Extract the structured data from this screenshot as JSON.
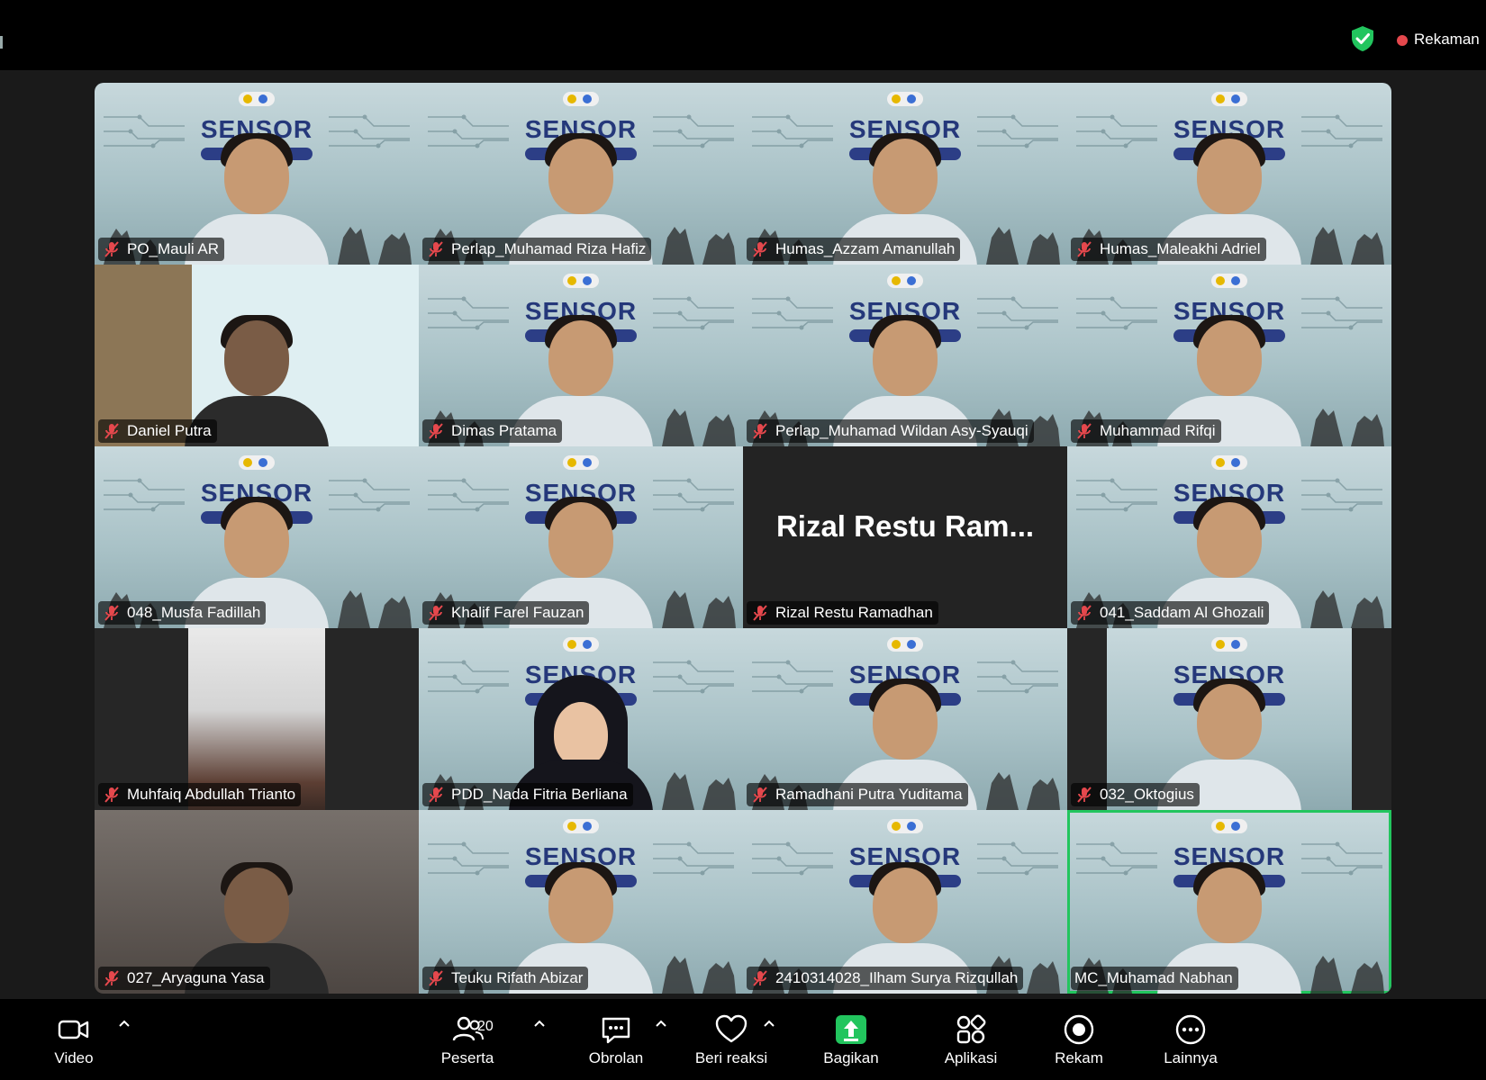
{
  "top_bar": {
    "recording_label": "Rekaman",
    "security_icon": "shield-check-icon",
    "recording_color": "#e5484d"
  },
  "gallery": {
    "active_speaker_color": "#22c55e",
    "participants": [
      {
        "name": "PO_Mauli AR",
        "muted": true
      },
      {
        "name": "Perlap_Muhamad Riza Hafiz",
        "muted": true
      },
      {
        "name": "Humas_Azzam Amanullah",
        "muted": true
      },
      {
        "name": "Humas_Maleakhi Adriel",
        "muted": true
      },
      {
        "name": "Daniel Putra",
        "muted": true
      },
      {
        "name": "Dimas Pratama",
        "muted": true
      },
      {
        "name": "Perlap_Muhamad Wildan Asy-Syauqi",
        "muted": true
      },
      {
        "name": "Muhammad Rifqi",
        "muted": true
      },
      {
        "name": "048_Musfa Fadillah",
        "muted": true
      },
      {
        "name": "Khalif Farel Fauzan",
        "muted": true
      },
      {
        "name": "Rizal Restu Ramadhan",
        "muted": true,
        "video_off_label": "Rizal Restu Ram..."
      },
      {
        "name": "041_Saddam Al Ghozali",
        "muted": true
      },
      {
        "name": "Muhfaiq Abdullah Trianto",
        "muted": true
      },
      {
        "name": "PDD_Nada Fitria Berliana",
        "muted": true
      },
      {
        "name": "Ramadhani Putra Yuditama",
        "muted": true
      },
      {
        "name": "032_Oktogius",
        "muted": true
      },
      {
        "name": "027_Aryaguna Yasa",
        "muted": true
      },
      {
        "name": "Teuku Rifath Abizar",
        "muted": true
      },
      {
        "name": "2410314028_Ilham Surya Rizqullah",
        "muted": true
      },
      {
        "name": "MC_Muhamad Nabhan",
        "muted": false,
        "active_speaker": true
      }
    ],
    "background_banner": {
      "word": "SENSOR",
      "subtitle": "KRSTI"
    }
  },
  "toolbar": {
    "video": {
      "label": "Video",
      "icon": "video-camera-icon"
    },
    "participants": {
      "label": "Peserta",
      "icon": "people-icon",
      "count": "20"
    },
    "chat": {
      "label": "Obrolan",
      "icon": "chat-icon"
    },
    "reactions": {
      "label": "Beri reaksi",
      "icon": "heart-icon"
    },
    "share": {
      "label": "Bagikan",
      "icon": "share-screen-icon",
      "color": "#22c55e"
    },
    "apps": {
      "label": "Aplikasi",
      "icon": "apps-icon"
    },
    "record": {
      "label": "Rekam",
      "icon": "record-icon"
    },
    "more": {
      "label": "Lainnya",
      "icon": "more-icon"
    }
  }
}
